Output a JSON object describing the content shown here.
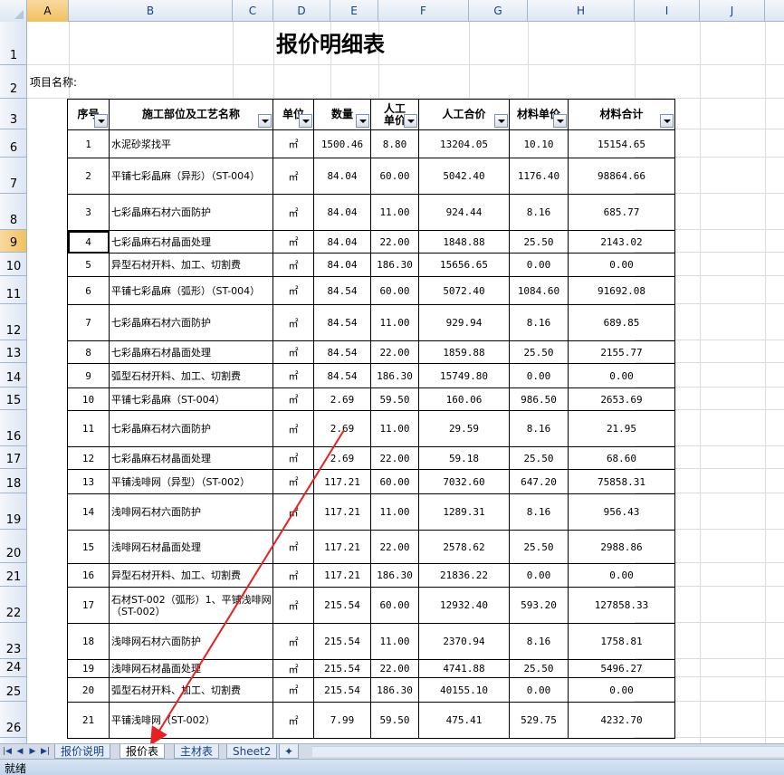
{
  "columns": [
    "A",
    "B",
    "C",
    "D",
    "E",
    "F",
    "G",
    "H",
    "I",
    "J"
  ],
  "selected_column": "A",
  "selected_row": "9",
  "row_headers": [
    "1",
    "2",
    "3",
    "6",
    "7",
    "8",
    "9",
    "10",
    "11",
    "12",
    "13",
    "14",
    "15",
    "16",
    "17",
    "18",
    "19",
    "20",
    "21",
    "22",
    "23",
    "24",
    "25",
    "26"
  ],
  "title": "报价明细表",
  "project_label": "项目名称:",
  "headers": [
    "序号",
    "施工部位及工艺名称",
    "单位",
    "数量",
    "人工单价",
    "人工合价",
    "材料单价",
    "材料合计"
  ],
  "rows": [
    [
      "1",
      "水泥砂浆找平",
      "㎡",
      "1500.46",
      "8.80",
      "13204.05",
      "10.10",
      "15154.65"
    ],
    [
      "2",
      "平铺七彩晶麻（异形）（ST-004）",
      "㎡",
      "84.04",
      "60.00",
      "5042.40",
      "1176.40",
      "98864.66"
    ],
    [
      "3",
      "七彩晶麻石材六面防护",
      "㎡",
      "84.04",
      "11.00",
      "924.44",
      "8.16",
      "685.77"
    ],
    [
      "4",
      "七彩晶麻石材晶面处理",
      "㎡",
      "84.04",
      "22.00",
      "1848.88",
      "25.50",
      "2143.02"
    ],
    [
      "5",
      "异型石材开料、加工、切割费",
      "㎡",
      "84.04",
      "186.30",
      "15656.65",
      "0.00",
      "0.00"
    ],
    [
      "6",
      "平铺七彩晶麻（弧形）（ST-004）",
      "㎡",
      "84.54",
      "60.00",
      "5072.40",
      "1084.60",
      "91692.08"
    ],
    [
      "7",
      "七彩晶麻石材六面防护",
      "㎡",
      "84.54",
      "11.00",
      "929.94",
      "8.16",
      "689.85"
    ],
    [
      "8",
      "七彩晶麻石材晶面处理",
      "㎡",
      "84.54",
      "22.00",
      "1859.88",
      "25.50",
      "2155.77"
    ],
    [
      "9",
      "弧型石材开料、加工、切割费",
      "㎡",
      "84.54",
      "186.30",
      "15749.80",
      "0.00",
      "0.00"
    ],
    [
      "10",
      "平铺七彩晶麻（ST-004）",
      "㎡",
      "2.69",
      "59.50",
      "160.06",
      "986.50",
      "2653.69"
    ],
    [
      "11",
      "七彩晶麻石材六面防护",
      "㎡",
      "2.69",
      "11.00",
      "29.59",
      "8.16",
      "21.95"
    ],
    [
      "12",
      "七彩晶麻石材晶面处理",
      "㎡",
      "2.69",
      "22.00",
      "59.18",
      "25.50",
      "68.60"
    ],
    [
      "13",
      "平铺浅啡网（异型）（ST-002）",
      "㎡",
      "117.21",
      "60.00",
      "7032.60",
      "647.20",
      "75858.31"
    ],
    [
      "14",
      "浅啡网石材六面防护",
      "㎡",
      "117.21",
      "11.00",
      "1289.31",
      "8.16",
      "956.43"
    ],
    [
      "15",
      "浅啡网石材晶面处理",
      "㎡",
      "117.21",
      "22.00",
      "2578.62",
      "25.50",
      "2988.86"
    ],
    [
      "16",
      "异型石材开料、加工、切割费",
      "㎡",
      "117.21",
      "186.30",
      "21836.22",
      "0.00",
      "0.00"
    ],
    [
      "17",
      "石材ST-002（弧形）1、平铺浅啡网（ST-002）",
      "㎡",
      "215.54",
      "60.00",
      "12932.40",
      "593.20",
      "127858.33"
    ],
    [
      "18",
      "浅啡网石材六面防护",
      "㎡",
      "215.54",
      "11.00",
      "2370.94",
      "8.16",
      "1758.81"
    ],
    [
      "19",
      "浅啡网石材晶面处理",
      "㎡",
      "215.54",
      "22.00",
      "4741.88",
      "25.50",
      "5496.27"
    ],
    [
      "20",
      "弧型石材开料、加工、切割费",
      "㎡",
      "215.54",
      "186.30",
      "40155.10",
      "0.00",
      "0.00"
    ],
    [
      "21",
      "平铺浅啡网（ST-002）",
      "㎡",
      "7.99",
      "59.50",
      "475.41",
      "529.75",
      "4232.70"
    ]
  ],
  "sheet_tabs": [
    "报价说明",
    "报价表",
    "主材表",
    "Sheet2"
  ],
  "active_tab": "报价表",
  "status": "就绪",
  "annotation_color": "#e8201e"
}
